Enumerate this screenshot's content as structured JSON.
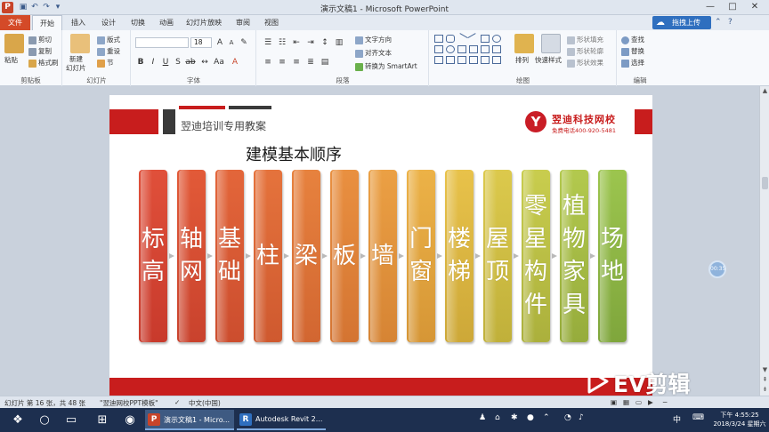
{
  "titlebar": {
    "title": "演示文稿1 - Microsoft PowerPoint",
    "app_icon": "P",
    "quick_access": [
      "save-icon",
      "undo-icon",
      "redo-icon",
      "customize-icon"
    ],
    "window_buttons": [
      "—",
      "□",
      "✕"
    ]
  },
  "tabs": [
    {
      "label": "文件"
    },
    {
      "label": "开始"
    },
    {
      "label": "插入"
    },
    {
      "label": "设计"
    },
    {
      "label": "切换"
    },
    {
      "label": "动画"
    },
    {
      "label": "幻灯片放映"
    },
    {
      "label": "审阅"
    },
    {
      "label": "视图"
    }
  ],
  "cloud_button": {
    "label": "拖拽上传"
  },
  "ribbon": {
    "clipboard": {
      "label": "剪贴板",
      "paste": "粘贴",
      "cut": "剪切",
      "copy": "复制",
      "format_painter": "格式刷"
    },
    "slides": {
      "label": "幻灯片",
      "new_slide": "新建",
      "new_slide2": "幻灯片",
      "layout": "版式",
      "reset": "重设",
      "section": "节"
    },
    "font": {
      "label": "字体",
      "size": "18"
    },
    "paragraph": {
      "label": "段落",
      "text_direction": "文字方向",
      "align_text": "对齐文本",
      "smartart": "转换为 SmartArt"
    },
    "drawing": {
      "label": "绘图",
      "arrange": "排列",
      "quick_styles": "快速样式",
      "shape_fill": "形状填充",
      "shape_outline": "形状轮廓",
      "shape_effects": "形状效果"
    },
    "editing": {
      "label": "编辑",
      "find": "查找",
      "replace": "替换",
      "select": "选择"
    }
  },
  "slide": {
    "header_title": "翌迪培训专用教案",
    "logo_letter": "Y",
    "logo_name": "翌迪科技网校",
    "logo_phone": "免费电话400-920-5481",
    "heading": "建模基本顺序",
    "steps": [
      {
        "chars": [
          "标",
          "高"
        ],
        "color_top": "#e0503a",
        "color_bottom": "#c83a2c"
      },
      {
        "chars": [
          "轴",
          "网"
        ],
        "color_top": "#e25a38",
        "color_bottom": "#c9422d"
      },
      {
        "chars": [
          "基",
          "础"
        ],
        "color_top": "#e3663a",
        "color_bottom": "#cc4d2e"
      },
      {
        "chars": [
          "柱"
        ],
        "color_top": "#e5733c",
        "color_bottom": "#cf592f"
      },
      {
        "chars": [
          "梁"
        ],
        "color_top": "#e7823e",
        "color_bottom": "#d26631"
      },
      {
        "chars": [
          "板"
        ],
        "color_top": "#e99040",
        "color_bottom": "#d47432"
      },
      {
        "chars": [
          "墙"
        ],
        "color_top": "#eba044",
        "color_bottom": "#d68434"
      },
      {
        "chars": [
          "门",
          "窗"
        ],
        "color_top": "#ecb247",
        "color_bottom": "#d69636"
      },
      {
        "chars": [
          "楼",
          "梯"
        ],
        "color_top": "#e8c24a",
        "color_bottom": "#cda838"
      },
      {
        "chars": [
          "屋",
          "顶"
        ],
        "color_top": "#dcc94c",
        "color_bottom": "#c0b03a"
      },
      {
        "chars": [
          "零",
          "星",
          "构",
          "件"
        ],
        "color_top": "#c9cd4e",
        "color_bottom": "#abb03c"
      },
      {
        "chars": [
          "植",
          "物",
          "家",
          "具"
        ],
        "color_top": "#b3c94e",
        "color_bottom": "#96ac3c"
      },
      {
        "chars": [
          "场",
          "地"
        ],
        "color_top": "#9cc54e",
        "color_bottom": "#7fa63c"
      }
    ]
  },
  "statusbar": {
    "slide_info": "幻灯片 第 16 张，共 48 张",
    "theme": "\"翌迪网校PPT模板\"",
    "language": "中文(中国)"
  },
  "taskbar": {
    "apps": [
      {
        "label": "演示文稿1 - Micro...",
        "icon": "P",
        "color": "#c8442a"
      },
      {
        "label": "Autodesk Revit 2...",
        "icon": "R",
        "color": "#2f6fbf"
      }
    ],
    "tray_ime": "中",
    "clock_time": "下午 4:55:25",
    "clock_date": "2018/3/24 星期六"
  },
  "watermark": {
    "text": "EV剪辑"
  },
  "floating_button": {
    "label": "00:35"
  }
}
